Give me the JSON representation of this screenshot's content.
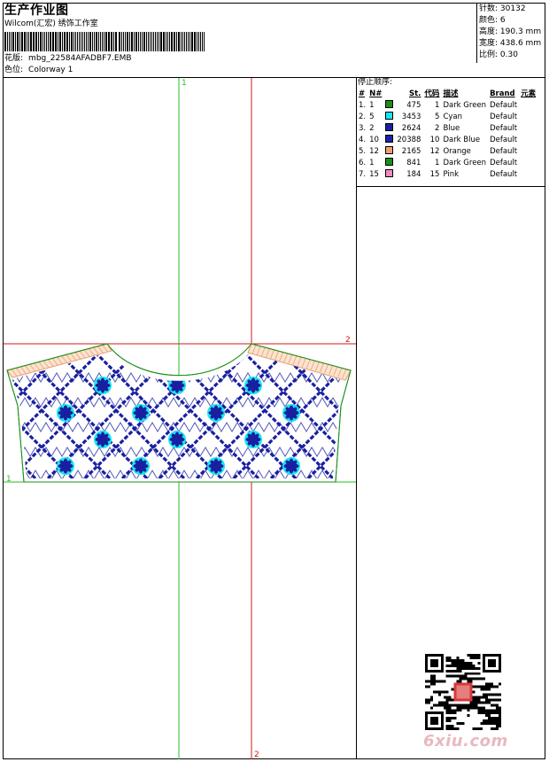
{
  "header": {
    "title": "生产作业图",
    "company": "Wilcom(汇宏) 绣饰工作室",
    "pattern_label": "花版:",
    "pattern_value": "mbg_22584AFADBF7.EMB",
    "colorway_label": "色位:",
    "colorway_value": "Colorway 1"
  },
  "stats": {
    "stitches_label": "针数:",
    "stitches_value": "30132",
    "colors_label": "颜色:",
    "colors_value": "6",
    "height_label": "高度:",
    "height_value": "190.3 mm",
    "width_label": "宽度:",
    "width_value": "438.6 mm",
    "scale_label": "比例:",
    "scale_value": "0.30"
  },
  "stop_sequence": {
    "title": "停止顺序:",
    "headers": [
      "#",
      "N#",
      "St.",
      "代码",
      "描述",
      "Brand",
      "元素"
    ],
    "rows": [
      {
        "idx": "1.",
        "n": "1",
        "color": "#1a8f1a",
        "st": "475",
        "code": "1",
        "desc": "Dark Green",
        "brand": "Default"
      },
      {
        "idx": "2.",
        "n": "5",
        "color": "#19e6f0",
        "st": "3453",
        "code": "5",
        "desc": "Cyan",
        "brand": "Default"
      },
      {
        "idx": "3.",
        "n": "2",
        "color": "#1a1fa0",
        "st": "2624",
        "code": "2",
        "desc": "Blue",
        "brand": "Default"
      },
      {
        "idx": "4.",
        "n": "10",
        "color": "#1a22a8",
        "st": "20388",
        "code": "10",
        "desc": "Dark Blue",
        "brand": "Default"
      },
      {
        "idx": "5.",
        "n": "12",
        "color": "#f0a070",
        "st": "2165",
        "code": "12",
        "desc": "Orange",
        "brand": "Default"
      },
      {
        "idx": "6.",
        "n": "1",
        "color": "#1a8f1a",
        "st": "841",
        "code": "1",
        "desc": "Dark Green",
        "brand": "Default"
      },
      {
        "idx": "7.",
        "n": "15",
        "color": "#f08cc0",
        "st": "184",
        "code": "15",
        "desc": "Pink",
        "brand": "Default"
      }
    ]
  },
  "guides": {
    "top_label": "1",
    "right_label": "2",
    "left_label": "1",
    "bottom_label": "2"
  },
  "colors": {
    "guide_green": "#22c022",
    "guide_red": "#d01818",
    "pattern_blue": "#1a1fa0",
    "pattern_cyan": "#19e6f0",
    "outline_green": "#1a8f1a",
    "shoulder_orange": "#e8a070"
  },
  "watermark": {
    "text": "6xiu.com"
  }
}
